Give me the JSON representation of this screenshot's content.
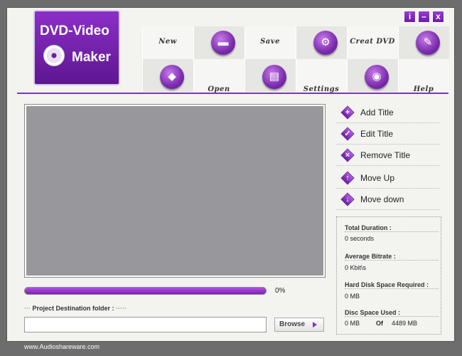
{
  "logo": {
    "line1": "DVD-Video",
    "line2": "Maker"
  },
  "window_controls": {
    "info": "i",
    "minimize": "–",
    "close": "x"
  },
  "toolbar": {
    "new": "New",
    "open": "Open",
    "save": "Save",
    "settings": "Settings",
    "create_dvd": "Creat DVD",
    "help": "Help"
  },
  "progress": {
    "percent_label": "0%",
    "value": 0
  },
  "destination": {
    "label": "Project Destination folder :",
    "value": "",
    "browse_label": "Browse"
  },
  "side_actions": [
    {
      "label": "Add Title",
      "icon": "plus-icon"
    },
    {
      "label": "Edit Title",
      "icon": "check-icon"
    },
    {
      "label": "Remove Title",
      "icon": "x-icon"
    },
    {
      "label": "Move Up",
      "icon": "arrow-up-icon"
    },
    {
      "label": "Move down",
      "icon": "arrow-down-icon"
    }
  ],
  "stats": {
    "total_duration_label": "Total Duration :",
    "total_duration_value": "0 seconds",
    "avg_bitrate_label": "Average Bitrate :",
    "avg_bitrate_value": "0 Kbit\\s",
    "hdd_label": "Hard Disk Space Required :",
    "hdd_value": "0 MB",
    "disc_label": "Disc Space Used :",
    "disc_used": "0 MB",
    "disc_of": "Of",
    "disc_total": "4489 MB"
  },
  "footer": {
    "url": "www.Audioshareware.com"
  },
  "colors": {
    "accent": "#7b2cae",
    "preview_bg": "#98989c",
    "frame": "#6d6d6d"
  }
}
